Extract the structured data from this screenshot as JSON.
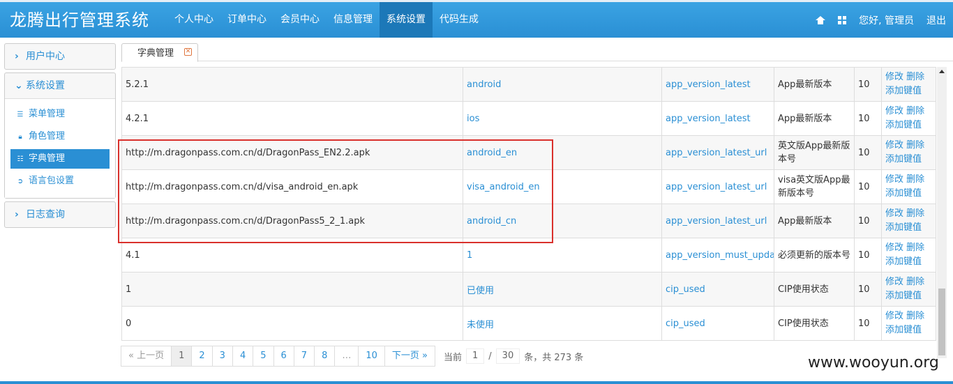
{
  "app": {
    "title": "龙腾出行管理系统"
  },
  "nav": {
    "items": [
      {
        "label": "个人中心"
      },
      {
        "label": "订单中心"
      },
      {
        "label": "会员中心"
      },
      {
        "label": "信息管理"
      },
      {
        "label": "系统设置",
        "active": true
      },
      {
        "label": "代码生成"
      }
    ],
    "greeting": "您好, 管理员",
    "logout": "退出"
  },
  "sidebar": {
    "user_center": "用户中心",
    "system_settings": "系统设置",
    "items": [
      {
        "label": "菜单管理",
        "icon": "list-icon"
      },
      {
        "label": "角色管理",
        "icon": "lock-icon"
      },
      {
        "label": "字典管理",
        "icon": "table-icon",
        "active": true
      },
      {
        "label": "语言包设置",
        "icon": "arrow-circle-icon"
      }
    ],
    "log_query": "日志查询"
  },
  "tab": {
    "label": "字典管理"
  },
  "table": {
    "rows": [
      {
        "value": "5.2.1",
        "label": "android",
        "type": "app_version_latest",
        "desc": "App最新版本",
        "sort": "10"
      },
      {
        "value": "4.2.1",
        "label": "ios",
        "type": "app_version_latest",
        "desc": "App最新版本",
        "sort": "10"
      },
      {
        "value": "http://m.dragonpass.com.cn/d/DragonPass_EN2.2.apk",
        "label": "android_en",
        "type": "app_version_latest_url",
        "desc": "英文版App最新版本号",
        "sort": "10"
      },
      {
        "value": "http://m.dragonpass.com.cn/d/visa_android_en.apk",
        "label": "visa_android_en",
        "type": "app_version_latest_url",
        "desc": "visa英文版App最新版本号",
        "sort": "10"
      },
      {
        "value": "http://m.dragonpass.com.cn/d/DragonPass5_2_1.apk",
        "label": "android_cn",
        "type": "app_version_latest_url",
        "desc": "App最新版本",
        "sort": "10"
      },
      {
        "value": "4.1",
        "label": "1",
        "type": "app_version_must_update",
        "desc": "必须更新的版本号",
        "sort": "10"
      },
      {
        "value": "1",
        "label": "已使用",
        "type": "cip_used",
        "desc": "CIP使用状态",
        "sort": "10"
      },
      {
        "value": "0",
        "label": "未使用",
        "type": "cip_used",
        "desc": "CIP使用状态",
        "sort": "10"
      }
    ],
    "ops": {
      "edit": "修改",
      "delete": "删除",
      "add_key": "添加键值"
    }
  },
  "pagination": {
    "prev": "« 上一页",
    "pages": [
      "1",
      "2",
      "3",
      "4",
      "5",
      "6",
      "7",
      "8",
      "…",
      "10"
    ],
    "next": "下一页 »",
    "current_label": "当前",
    "current": "1",
    "sep": "/",
    "total_pages": "30",
    "total_text": "条，共 273 条"
  },
  "watermark": "www.wooyun.org",
  "colors": {
    "primary": "#2a8fd4",
    "active_nav": "#1c78b8",
    "highlight": "#d9302c"
  }
}
